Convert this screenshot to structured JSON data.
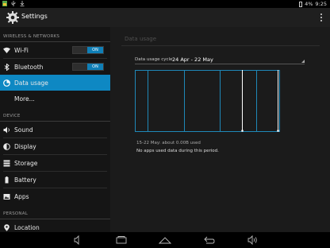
{
  "status_bar": {
    "battery_text": "4%",
    "time": "9:25",
    "left_icons": [
      "gallery-icon",
      "usb-icon",
      "download-icon"
    ]
  },
  "action_bar": {
    "title": "Settings"
  },
  "sidebar": {
    "sections": [
      {
        "header": "WIRELESS & NETWORKS",
        "items": [
          {
            "label": "Wi-Fi",
            "icon": "wifi-icon",
            "toggle": "ON"
          },
          {
            "label": "Bluetooth",
            "icon": "bluetooth-icon",
            "toggle": "ON"
          },
          {
            "label": "Data usage",
            "icon": "data-usage-icon",
            "active": true
          },
          {
            "label": "More...",
            "icon": ""
          }
        ]
      },
      {
        "header": "DEVICE",
        "items": [
          {
            "label": "Sound",
            "icon": "speaker-icon"
          },
          {
            "label": "Display",
            "icon": "display-icon"
          },
          {
            "label": "Storage",
            "icon": "storage-icon"
          },
          {
            "label": "Battery",
            "icon": "battery-icon"
          },
          {
            "label": "Apps",
            "icon": "apps-icon"
          }
        ]
      },
      {
        "header": "PERSONAL",
        "items": [
          {
            "label": "Location",
            "icon": "location-icon"
          }
        ]
      }
    ]
  },
  "main": {
    "heading": "Data usage",
    "cycle_label": "Data usage cycle",
    "cycle_value": "24 Apr - 22 May",
    "usage_range": "15-22 May: about 0.00B used",
    "no_data_text": "No apps used data during this period."
  },
  "colors": {
    "accent": "#0e88c3",
    "chart_line": "#1f88b8",
    "chart_marker": "#ffffff"
  },
  "navbar": {
    "icons": [
      "volume-down-icon",
      "recent-apps-icon",
      "home-icon",
      "back-icon",
      "volume-up-icon"
    ]
  }
}
